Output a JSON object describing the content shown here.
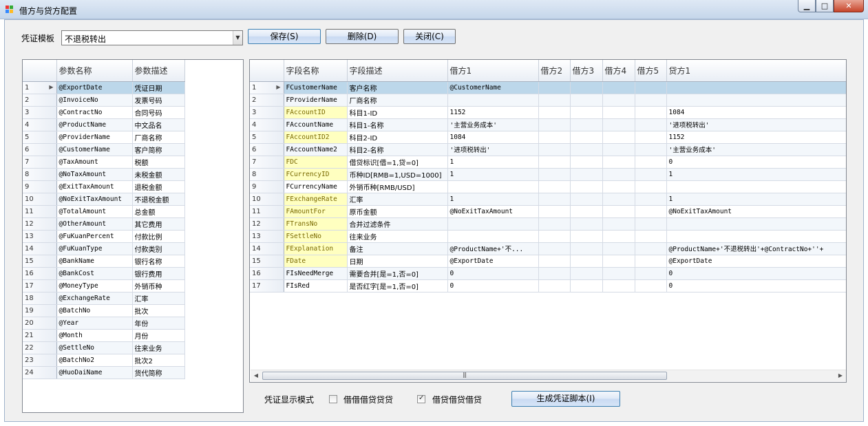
{
  "window": {
    "title": "借方与贷方配置"
  },
  "toolbar": {
    "template_label": "凭证模板",
    "template_value": "不退税转出",
    "save_label": "保存(S)",
    "delete_label": "删除(D)",
    "close_label": "关闭(C)"
  },
  "param_grid": {
    "headers": [
      "参数名称",
      "参数描述"
    ],
    "rows": [
      [
        "1",
        "@ExportDate",
        "凭证日期"
      ],
      [
        "2",
        "@InvoiceNo",
        "发票号码"
      ],
      [
        "3",
        "@ContractNo",
        "合同号码"
      ],
      [
        "4",
        "@ProductName",
        "中文品名"
      ],
      [
        "5",
        "@ProviderName",
        "厂商名称"
      ],
      [
        "6",
        "@CustomerName",
        "客户简称"
      ],
      [
        "7",
        "@TaxAmount",
        "税额"
      ],
      [
        "8",
        "@NoTaxAmount",
        "未税金额"
      ],
      [
        "9",
        "@ExitTaxAmount",
        "退税金额"
      ],
      [
        "10",
        "@NoExitTaxAmount",
        "不退税金额"
      ],
      [
        "11",
        "@TotalAmount",
        "总金额"
      ],
      [
        "12",
        "@OtherAmount",
        "其它费用"
      ],
      [
        "13",
        "@FuKuanPercent",
        "付款比例"
      ],
      [
        "14",
        "@FuKuanType",
        "付款类别"
      ],
      [
        "15",
        "@BankName",
        "银行名称"
      ],
      [
        "16",
        "@BankCost",
        "银行费用"
      ],
      [
        "17",
        "@MoneyType",
        "外销币种"
      ],
      [
        "18",
        "@ExchangeRate",
        "汇率"
      ],
      [
        "19",
        "@BatchNo",
        "批次"
      ],
      [
        "20",
        "@Year",
        "年份"
      ],
      [
        "21",
        "@Month",
        "月份"
      ],
      [
        "22",
        "@SettleNo",
        "往来业务"
      ],
      [
        "23",
        "@BatchNo2",
        "批次2"
      ],
      [
        "24",
        "@HuoDaiName",
        "货代简称"
      ]
    ]
  },
  "field_grid": {
    "headers": [
      "字段名称",
      "字段描述",
      "借方1",
      "借方2",
      "借方3",
      "借方4",
      "借方5",
      "贷方1"
    ],
    "rows": [
      {
        "n": "1",
        "name": "FCustomerName",
        "desc": "客户名称",
        "d1": "@CustomerName",
        "c1": "",
        "y": false
      },
      {
        "n": "2",
        "name": "FProviderName",
        "desc": "厂商名称",
        "d1": "",
        "c1": "",
        "y": false
      },
      {
        "n": "3",
        "name": "FAccountID",
        "desc": "科目1-ID",
        "d1": "1152",
        "c1": "1084",
        "y": true
      },
      {
        "n": "4",
        "name": "FAccountName",
        "desc": "科目1-名称",
        "d1": "'主营业务成本'",
        "c1": "'进项税转出'",
        "y": false
      },
      {
        "n": "5",
        "name": "FAccountID2",
        "desc": "科目2-ID",
        "d1": "1084",
        "c1": "1152",
        "y": true
      },
      {
        "n": "6",
        "name": "FAccountName2",
        "desc": "科目2-名称",
        "d1": "'进项税转出'",
        "c1": "'主营业务成本'",
        "y": false
      },
      {
        "n": "7",
        "name": "FDC",
        "desc": "借贷标识[借=1,贷=0]",
        "d1": "1",
        "c1": "0",
        "y": true
      },
      {
        "n": "8",
        "name": "FCurrencyID",
        "desc": "币种ID[RMB=1,USD=1000]",
        "d1": "1",
        "c1": "1",
        "y": true
      },
      {
        "n": "9",
        "name": "FCurrencyName",
        "desc": "外销币种[RMB/USD]",
        "d1": "",
        "c1": "",
        "y": false
      },
      {
        "n": "10",
        "name": "FExchangeRate",
        "desc": "汇率",
        "d1": "1",
        "c1": "1",
        "y": true
      },
      {
        "n": "11",
        "name": "FAmountFor",
        "desc": "原币金额",
        "d1": "@NoExitTaxAmount",
        "c1": "@NoExitTaxAmount",
        "y": true
      },
      {
        "n": "12",
        "name": "FTransNo",
        "desc": "合并过滤条件",
        "d1": "",
        "c1": "",
        "y": true
      },
      {
        "n": "13",
        "name": "FSettleNo",
        "desc": "往来业务",
        "d1": "",
        "c1": "",
        "y": true
      },
      {
        "n": "14",
        "name": "FExplanation",
        "desc": "备注",
        "d1": "@ProductName+'不...",
        "c1": "@ProductName+'不退税转出'+@ContractNo+''+",
        "y": true
      },
      {
        "n": "15",
        "name": "FDate",
        "desc": "日期",
        "d1": "@ExportDate",
        "c1": "@ExportDate",
        "y": true
      },
      {
        "n": "16",
        "name": "FIsNeedMerge",
        "desc": "需要合并[是=1,否=0]",
        "d1": "0",
        "c1": "0",
        "y": false
      },
      {
        "n": "17",
        "name": "FIsRed",
        "desc": "是否红字[是=1,否=0]",
        "d1": "0",
        "c1": "0",
        "y": false
      }
    ]
  },
  "bottom": {
    "mode_label": "凭证显示模式",
    "opt1_label": "借借借贷贷贷",
    "opt2_label": "借贷借贷借贷",
    "opt1_checked": false,
    "opt2_checked": true,
    "generate_label": "生成凭证脚本(I)"
  },
  "icons": {
    "scroll_left": "scroll-left-icon",
    "scroll_right": "scroll-right-icon",
    "row_pointer": "row-pointer-icon"
  },
  "colors": {
    "selected_row": "#bcd7ea",
    "key_field": "#ffffc0",
    "key_field_text": "#7a6a00"
  }
}
